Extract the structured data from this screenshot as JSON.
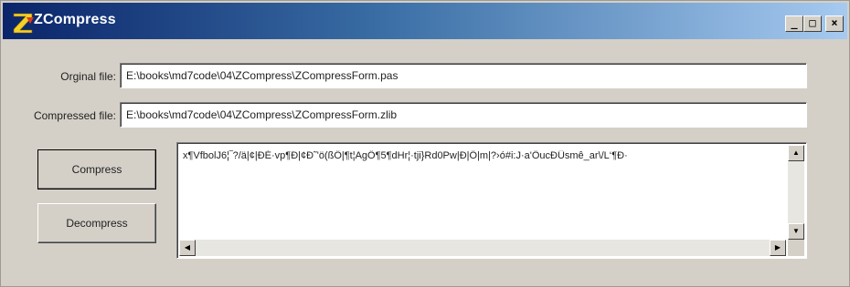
{
  "window": {
    "title": "ZCompress",
    "controls": {
      "minimize": "_",
      "maximize": "□",
      "close": "×"
    }
  },
  "form": {
    "original_label": "Orginal file:",
    "original_value": "E:\\books\\md7code\\04\\ZCompress\\ZCompressForm.pas",
    "compressed_label": "Compressed file:",
    "compressed_value": "E:\\books\\md7code\\04\\ZCompress\\ZCompressForm.zlib"
  },
  "buttons": {
    "compress_label": "Compress",
    "decompress_label": "Decompress"
  },
  "memo": {
    "content": "x¶VfbolJ6¦‾?/ä|¢|ÐÉ·vp¶Ð|¢Ð˜'ö(ßÔ|¶t¦AgÖ¶5¶dHr¦·tji}Rd0Pw|Ð|Ö|m|?›ó#i:J·a'ÖucÐÛsmê_ar\\/L‘¶Ð·",
    "scroll_up": "▲",
    "scroll_down": "▼",
    "scroll_left": "◀",
    "scroll_right": "▶"
  },
  "colors": {
    "face": "#d4d0c8",
    "title_start": "#0a246a",
    "title_end": "#a6caf0"
  }
}
